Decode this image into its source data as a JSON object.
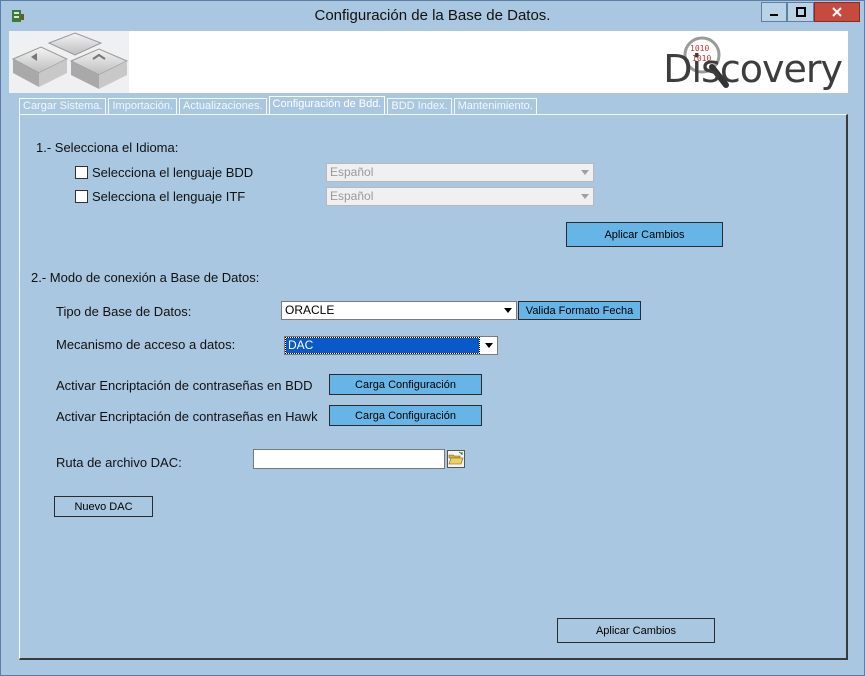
{
  "window": {
    "title": "Configuración de la Base de Datos."
  },
  "banner": {
    "logo_text": "Discovery",
    "logo_badge": "1010"
  },
  "tabs": [
    {
      "label": "Cargar Sistema."
    },
    {
      "label": "Importación."
    },
    {
      "label": "Actualizaciones."
    },
    {
      "label": "Configuración de Bdd."
    },
    {
      "label": "BDD Index."
    },
    {
      "label": "Mantenimiento."
    }
  ],
  "active_tab": "Configuración de Bdd.",
  "section1": {
    "heading": "1.- Selecciona el Idioma:",
    "bdd_checkbox_label": "Selecciona el lenguaje BDD",
    "bdd_checked": false,
    "bdd_language_value": "Español",
    "itf_checkbox_label": "Selecciona el lenguaje ITF",
    "itf_checked": false,
    "itf_language_value": "Español",
    "apply_button": "Aplicar Cambios"
  },
  "section2": {
    "heading": "2.- Modo de conexión a Base de Datos:",
    "db_type_label": "Tipo de Base de Datos:",
    "db_type_value": "ORACLE",
    "validate_date_button": "Valida Formato Fecha",
    "access_label": "Mecanismo de acceso a datos:",
    "access_value": "DAC",
    "encrypt_bdd_label": "Activar Encriptación de contraseñas en BDD",
    "encrypt_bdd_button": "Carga Configuración",
    "encrypt_hawk_label": "Activar Encriptación de contraseñas en Hawk",
    "encrypt_hawk_button": "Carga Configuración",
    "dac_path_label": "Ruta de archivo DAC:",
    "dac_path_value": "",
    "new_dac_button": "Nuevo DAC"
  },
  "footer": {
    "apply_button": "Aplicar Cambios"
  },
  "colors": {
    "background": "#a9c7e0",
    "button_blue": "#67b4e6",
    "selection": "#0a59c8",
    "close_red": "#c74a3f"
  }
}
